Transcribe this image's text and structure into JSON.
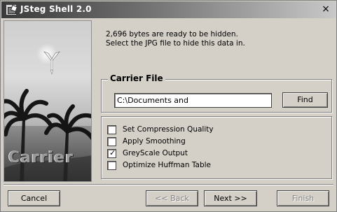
{
  "window": {
    "title": "JSteg Shell 2.0",
    "close_glyph": "×"
  },
  "banner": {
    "text": "Carrier"
  },
  "intro": {
    "line1": "2,696 bytes are ready to be hidden.",
    "line2": "Select the JPG file to hide this data in."
  },
  "carrier_file": {
    "group_title": "Carrier File",
    "path_value": "C:\\Documents and",
    "find_label": "Find"
  },
  "options": [
    {
      "label": "Set Compression Quality",
      "checked": false
    },
    {
      "label": "Apply Smoothing",
      "checked": false
    },
    {
      "label": "GreyScale Output",
      "checked": true
    },
    {
      "label": "Optimize Huffman Table",
      "checked": false
    }
  ],
  "footer": {
    "cancel_label": "Cancel",
    "back_label": "<< Back",
    "next_label": "Next >>",
    "finish_label": "Finish"
  }
}
